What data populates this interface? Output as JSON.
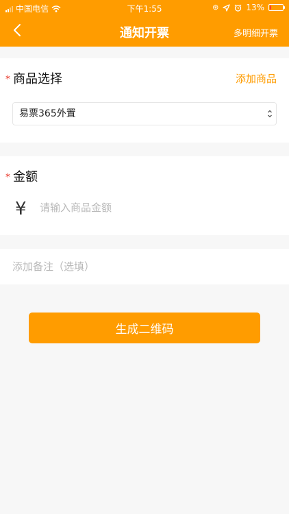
{
  "status_bar": {
    "carrier": "中国电信",
    "time": "下午1:55",
    "battery": "13%",
    "battery_level": 0.13,
    "icons": [
      "signal-icon",
      "wifi-icon",
      "orientation-lock-icon",
      "location-icon",
      "alarm-icon",
      "battery-icon"
    ]
  },
  "nav": {
    "back_icon": "chevron-left-icon",
    "title": "通知开票",
    "right_action": "多明细开票"
  },
  "product": {
    "required_mark": "*",
    "label": "商品选择",
    "add_link": "添加商品",
    "selected": "易票365外置"
  },
  "amount": {
    "required_mark": "*",
    "label": "金额",
    "currency_symbol": "¥",
    "placeholder": "请输入商品金额",
    "value": ""
  },
  "remark": {
    "placeholder": "添加备注（选填）",
    "value": ""
  },
  "submit": {
    "label": "生成二维码"
  },
  "colors": {
    "accent": "#ff9c00",
    "required": "#e93a2d",
    "background": "#f7f7f7"
  }
}
